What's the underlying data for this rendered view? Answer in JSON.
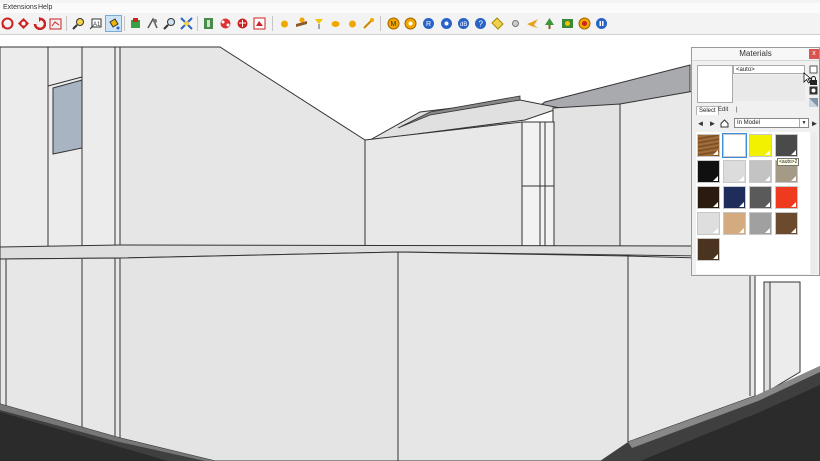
{
  "menu": {
    "items": [
      {
        "label": "Extensions"
      },
      {
        "label": "Help"
      }
    ]
  },
  "toolbar": {
    "icons": [
      "orbit-icon",
      "dimension-icon",
      "rotate-icon",
      "component-icon",
      "zoom-window-icon",
      "text-label-icon",
      "paint-bucket-icon",
      "follow-me-icon",
      "walk-icon",
      "zoom-icon",
      "zoom-extents-icon",
      "section-plane-icon",
      "component-browser-icon",
      "materials-icon",
      "extension-warehouse-icon",
      "sun-icon",
      "shadow-icon",
      "light-icon",
      "sphere-icon",
      "fog-icon",
      "render-icon",
      "render-settings-icon",
      "ruby-icon",
      "info-icon",
      "help-icon",
      "tag-icon",
      "view-icon",
      "move-icon",
      "plant-icon",
      "record-icon",
      "pause-icon"
    ]
  },
  "materials_panel": {
    "title": "Materials",
    "close_label": "x",
    "name_value": "<auto>",
    "tabs": [
      {
        "label": "Select"
      },
      {
        "label": "Edit"
      },
      {
        "label": "|"
      }
    ],
    "collection": "In Model",
    "tooltip": "<auto>2",
    "swatches": [
      {
        "color": "#8a5a2b",
        "texture": "wood"
      },
      {
        "color": "#ffffff",
        "selected": true
      },
      {
        "color": "#f2f200"
      },
      {
        "color": "#4a4a4a"
      },
      {
        "color": "#101010"
      },
      {
        "color": "#dcdcdc"
      },
      {
        "color": "#c3c3c3"
      },
      {
        "color": "#a49a86"
      },
      {
        "color": "#2b1a10"
      },
      {
        "color": "#1f2d5c"
      },
      {
        "color": "#5a5a5a"
      },
      {
        "color": "#f03a20"
      },
      {
        "color": "#dedede"
      },
      {
        "color": "#d4ab7e"
      },
      {
        "color": "#a0a0a0"
      },
      {
        "color": "#6b4a2d"
      },
      {
        "color": "#4a3420"
      }
    ]
  }
}
